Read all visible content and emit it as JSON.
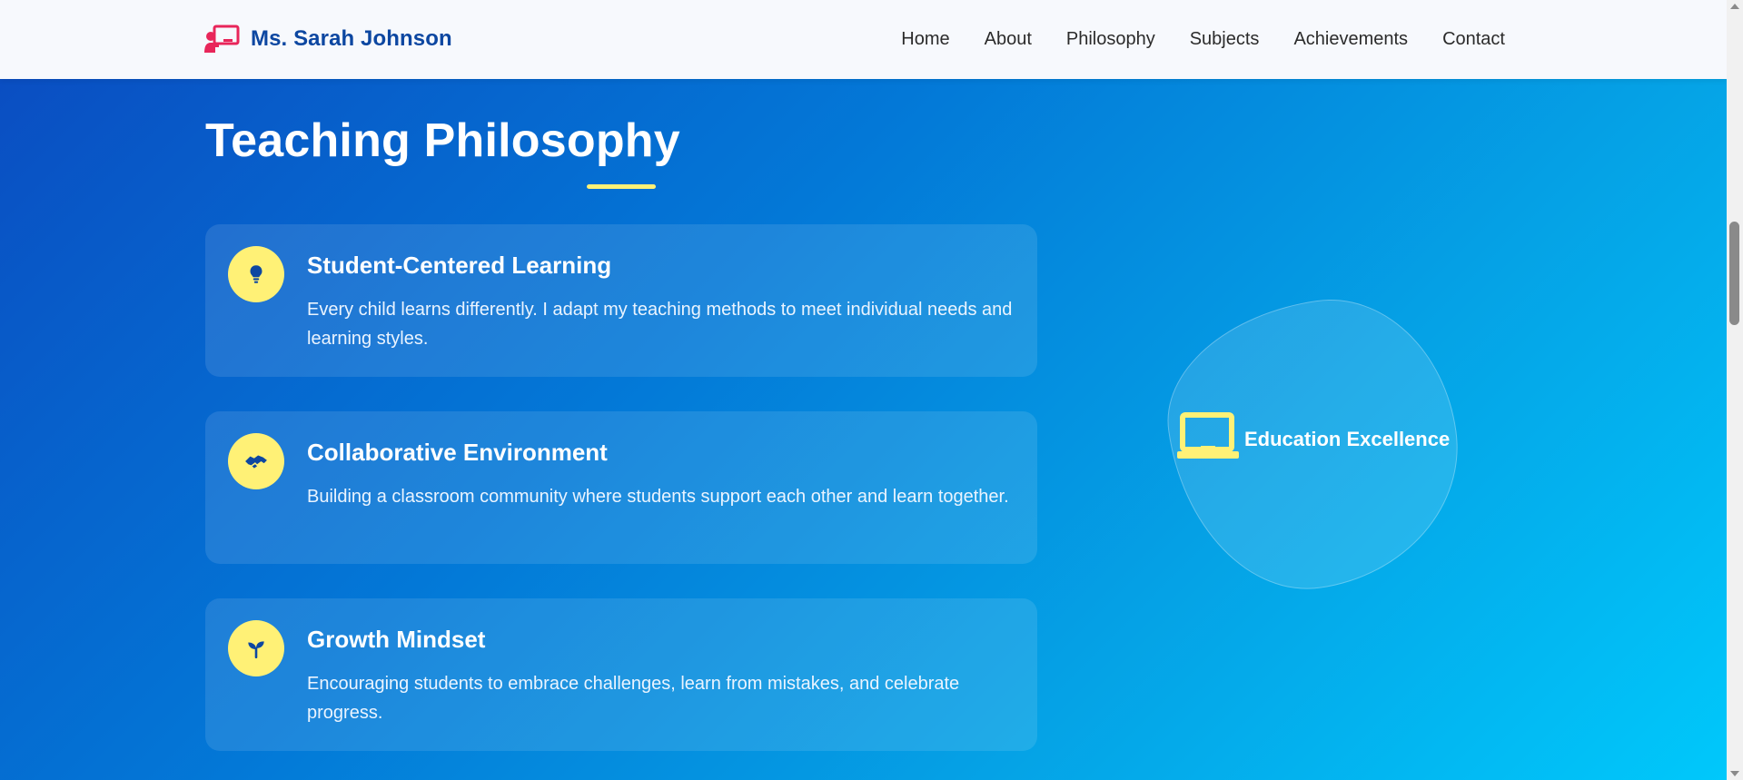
{
  "header": {
    "brand_name": "Ms. Sarah Johnson",
    "brand_icon": "teacher-chalkboard-icon",
    "nav": [
      "Home",
      "About",
      "Philosophy",
      "Subjects",
      "Achievements",
      "Contact"
    ]
  },
  "philosophy": {
    "title": "Teaching Philosophy",
    "cards": [
      {
        "icon": "lightbulb-icon",
        "title": "Student-Centered Learning",
        "text": "Every child learns differently. I adapt my teaching methods to meet individual needs and learning styles."
      },
      {
        "icon": "handshake-icon",
        "title": "Collaborative Environment",
        "text": "Building a classroom community where students support each other and learn together."
      },
      {
        "icon": "seedling-icon",
        "title": "Growth Mindset",
        "text": "Encouraging students to embrace challenges, learn from mistakes, and celebrate progress."
      }
    ],
    "badge": {
      "icon": "laptop-icon",
      "label": "Education Excellence"
    }
  },
  "colors": {
    "brand": "#0d47a1",
    "accent": "#fff176",
    "icon_red": "#e8265a",
    "gradient_start": "#0a4ec2",
    "gradient_end": "#00c8fb"
  }
}
